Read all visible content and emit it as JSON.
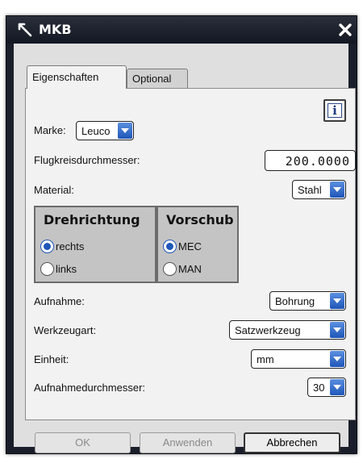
{
  "window": {
    "title": "MKB",
    "close_icon": "close-icon",
    "app_icon": "pin-icon"
  },
  "tabs": [
    {
      "label": "Eigenschaften",
      "active": true
    },
    {
      "label": "Optional",
      "active": false
    }
  ],
  "info_button": {
    "icon": "info-icon",
    "glyph": "i"
  },
  "marke": {
    "label": "Marke:",
    "value": "Leuco"
  },
  "flugkreis": {
    "label": "Flugkreisdurchmesser:",
    "value": "200.0000"
  },
  "material": {
    "label": "Material:",
    "value": "Stahl"
  },
  "drehrichtung": {
    "title": "Drehrichtung",
    "options": [
      {
        "label": "rechts",
        "selected": true
      },
      {
        "label": "links",
        "selected": false
      }
    ]
  },
  "vorschub": {
    "title": "Vorschub",
    "options": [
      {
        "label": "MEC",
        "selected": true
      },
      {
        "label": "MAN",
        "selected": false
      }
    ]
  },
  "aufnahme": {
    "label": "Aufnahme:",
    "value": "Bohrung"
  },
  "werkzeugart": {
    "label": "Werkzeugart:",
    "value": "Satzwerkzeug"
  },
  "einheit": {
    "label": "Einheit:",
    "value": "mm"
  },
  "aufnahmedurchmesser": {
    "label": "Aufnahmedurchmesser:",
    "value": "30"
  },
  "buttons": {
    "ok": "OK",
    "apply": "Anwenden",
    "cancel": "Abbrechen"
  },
  "colors": {
    "accent": "#1f56b8",
    "titlebar": "#1a1e2a",
    "panel": "#dfdfdf",
    "group": "#c4c4c4"
  }
}
